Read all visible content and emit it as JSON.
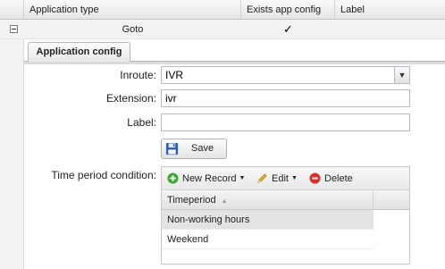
{
  "grid": {
    "columns": [
      "Application type",
      "Exists app config",
      "Label"
    ],
    "row": {
      "app_type": "Goto",
      "exists_config": "✓",
      "label": ""
    }
  },
  "tab": {
    "label": "Application config"
  },
  "form": {
    "inroute_label": "Inroute:",
    "inroute_value": "IVR",
    "extension_label": "Extension:",
    "extension_value": "ivr",
    "label_label": "Label:",
    "label_value": "",
    "save_label": "Save",
    "timeperiod_label": "Time period condition:"
  },
  "timeperiod_grid": {
    "toolbar": {
      "new_record": "New Record",
      "edit": "Edit",
      "delete": "Delete"
    },
    "column_header": "Timeperiod",
    "rows": [
      "Non-working hours",
      "Weekend"
    ]
  },
  "icons": {
    "new_record": "plus-circle-icon",
    "edit": "pencil-icon",
    "delete": "minus-circle-icon",
    "save": "floppy-disk-icon",
    "collapse": "minus-box-icon"
  },
  "colors": {
    "new_record_green": "#3fa535",
    "delete_red": "#d9322b",
    "save_blue": "#2f5fb3"
  }
}
